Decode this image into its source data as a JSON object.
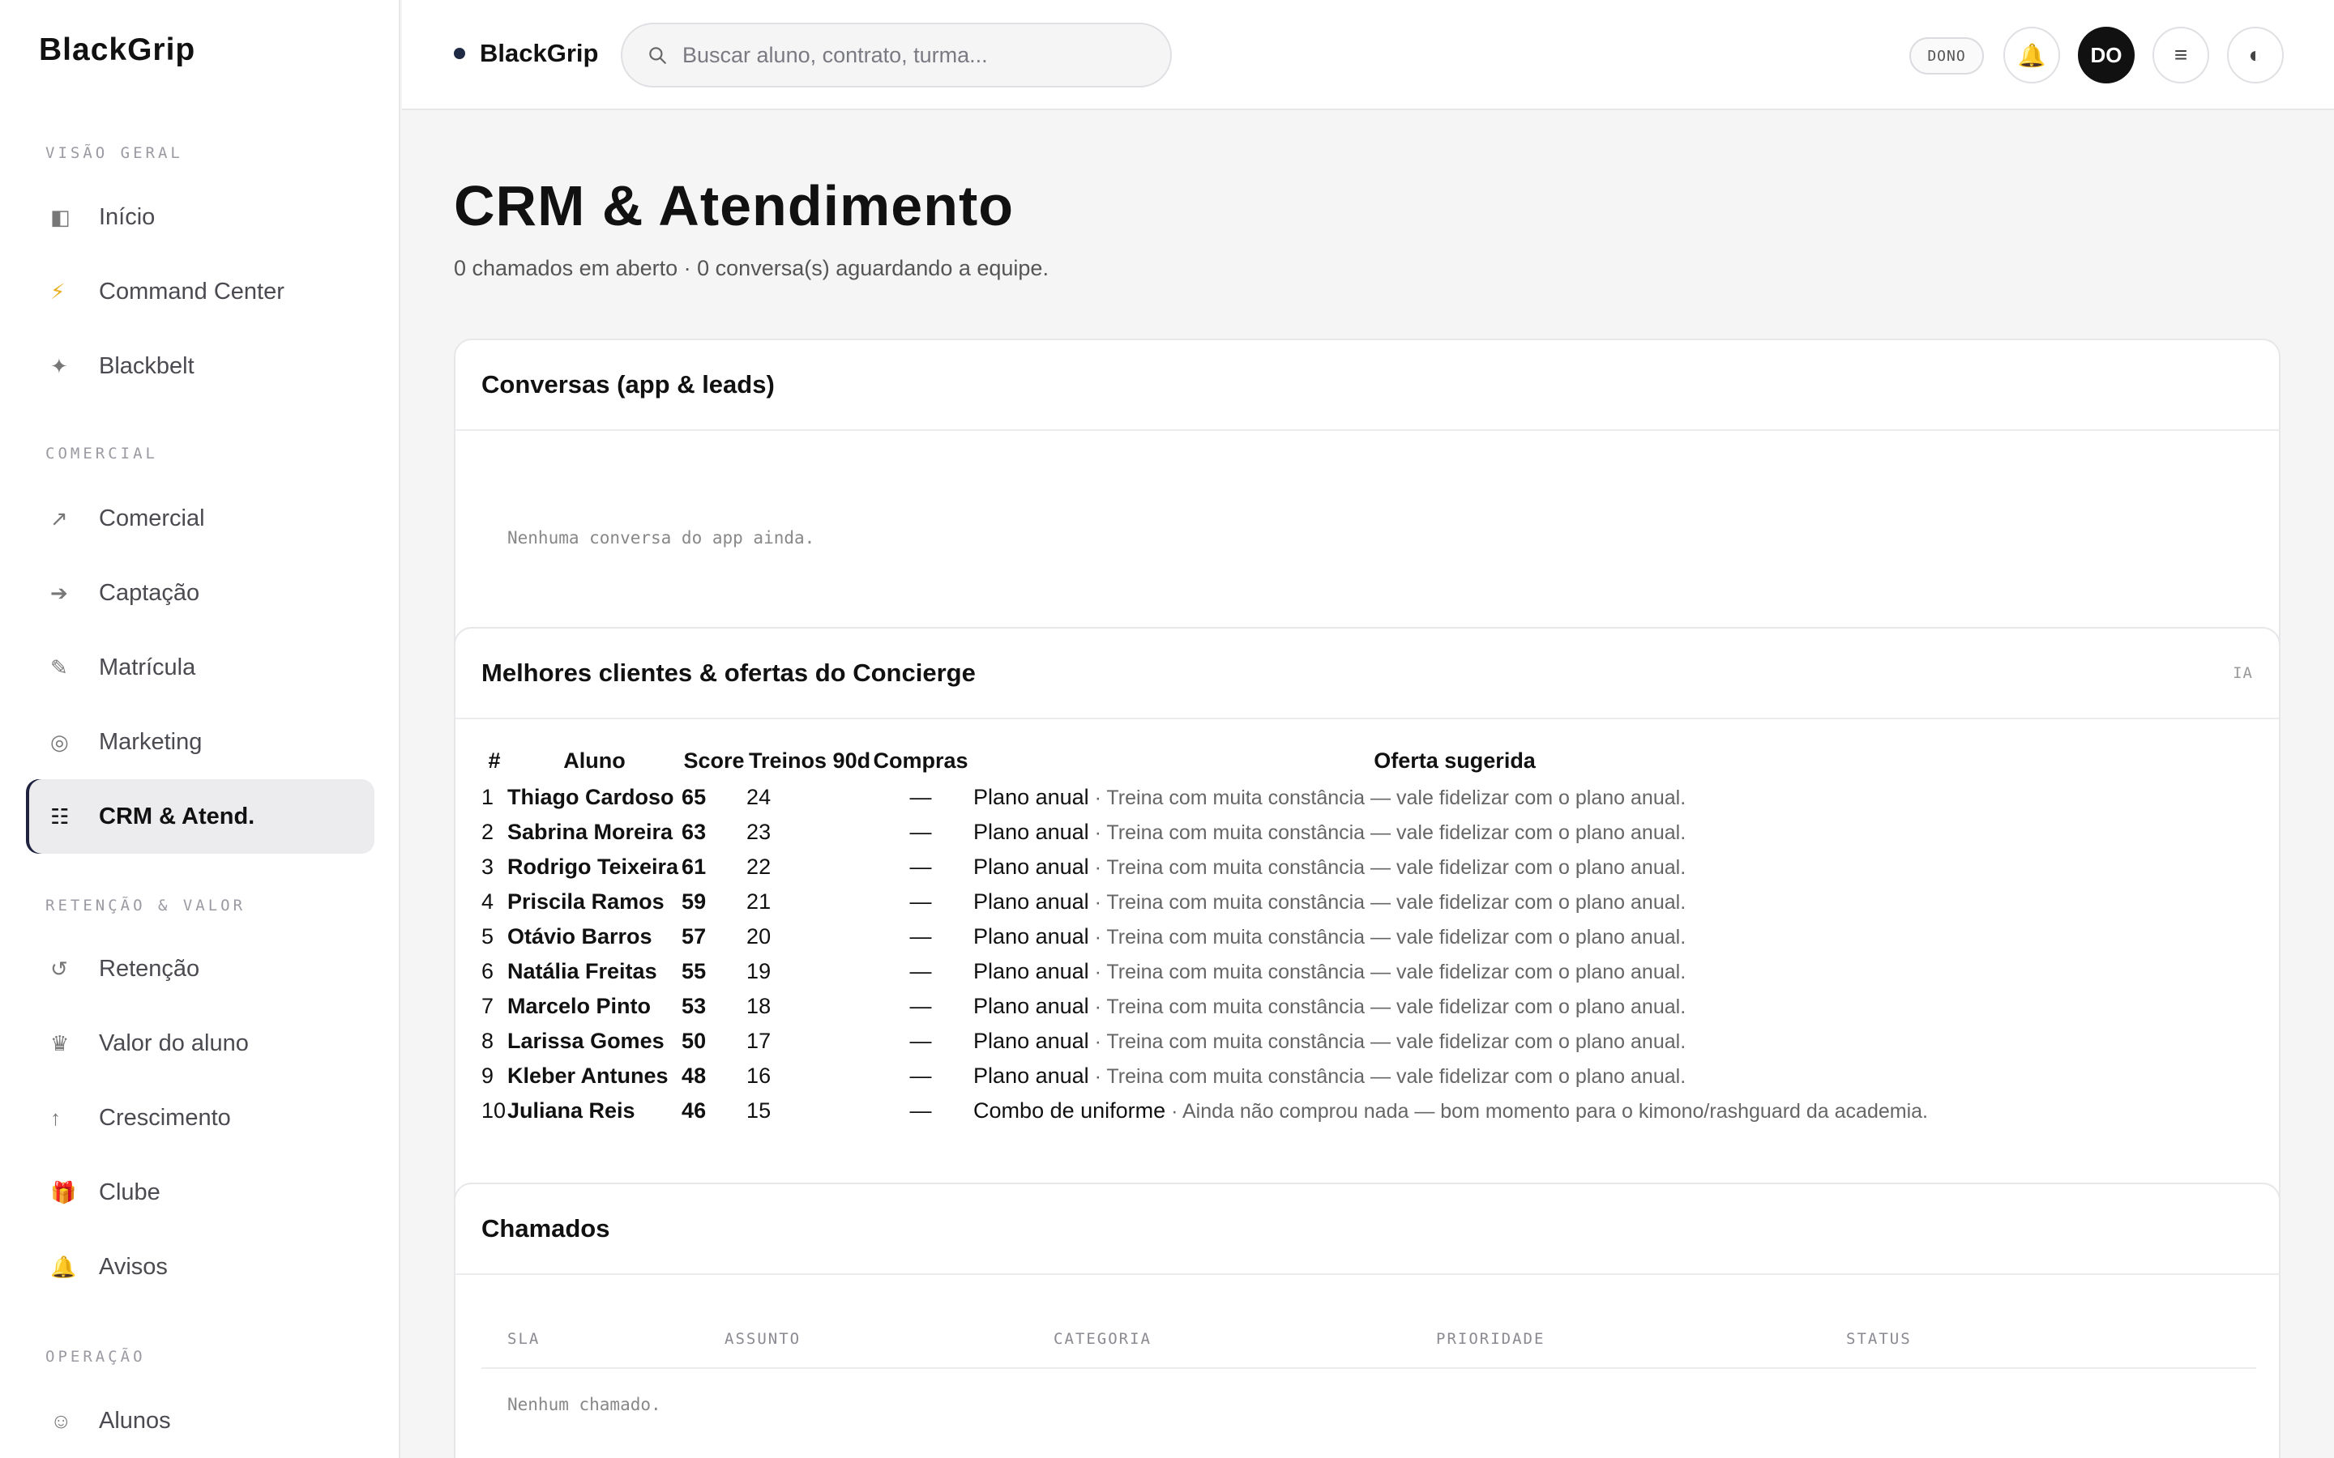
{
  "app": {
    "name": "BlackGrip"
  },
  "sidebar": {
    "brand": "BlackGrip",
    "sections": [
      {
        "title": "VISÃO GERAL"
      },
      {
        "title": "COMERCIAL"
      },
      {
        "title": "RETENÇÃO & VALOR"
      },
      {
        "title": "OPERAÇÃO"
      }
    ],
    "items": [
      {
        "label": "Início",
        "icon": "◧"
      },
      {
        "label": "Command Center",
        "icon": "⚡"
      },
      {
        "label": "Blackbelt",
        "icon": "✦"
      },
      {
        "label": "Comercial",
        "icon": "↗"
      },
      {
        "label": "Captação",
        "icon": "➔"
      },
      {
        "label": "Matrícula",
        "icon": "✎"
      },
      {
        "label": "Marketing",
        "icon": "◎"
      },
      {
        "label": "CRM & Atend.",
        "icon": "☷"
      },
      {
        "label": "Retenção",
        "icon": "↺"
      },
      {
        "label": "Valor do aluno",
        "icon": "♛"
      },
      {
        "label": "Crescimento",
        "icon": "↑"
      },
      {
        "label": "Clube",
        "icon": "🎁"
      },
      {
        "label": "Avisos",
        "icon": "🔔"
      },
      {
        "label": "Alunos",
        "icon": "☺"
      }
    ]
  },
  "topbar": {
    "brand": "BlackGrip",
    "search_placeholder": "Buscar aluno, contrato, turma...",
    "role_badge": "DONO",
    "avatar_initials": "DO",
    "bell_icon": "🔔",
    "menu_icon": "≡",
    "theme_icon": "◐"
  },
  "page": {
    "title": "CRM & Atendimento",
    "subtitle": "0 chamados em aberto · 0 conversa(s) aguardando a equipe."
  },
  "conversations": {
    "title": "Conversas (app & leads)",
    "empty": "Nenhuma conversa do app ainda."
  },
  "clients": {
    "title": "Melhores clientes & ofertas do Concierge",
    "badge": "IA",
    "columns": [
      "#",
      "Aluno",
      "Score",
      "Treinos 90d",
      "Compras",
      "Oferta sugerida"
    ],
    "rows": [
      {
        "rank": "1",
        "name": "Thiago Cardoso",
        "score": "65",
        "trainings": "24",
        "purchases": "—",
        "offer": "Plano anual",
        "reason": " · Treina com muita constância — vale fidelizar com o plano anual."
      },
      {
        "rank": "2",
        "name": "Sabrina Moreira",
        "score": "63",
        "trainings": "23",
        "purchases": "—",
        "offer": "Plano anual",
        "reason": " · Treina com muita constância — vale fidelizar com o plano anual."
      },
      {
        "rank": "3",
        "name": "Rodrigo Teixeira",
        "score": "61",
        "trainings": "22",
        "purchases": "—",
        "offer": "Plano anual",
        "reason": " · Treina com muita constância — vale fidelizar com o plano anual."
      },
      {
        "rank": "4",
        "name": "Priscila Ramos",
        "score": "59",
        "trainings": "21",
        "purchases": "—",
        "offer": "Plano anual",
        "reason": " · Treina com muita constância — vale fidelizar com o plano anual."
      },
      {
        "rank": "5",
        "name": "Otávio Barros",
        "score": "57",
        "trainings": "20",
        "purchases": "—",
        "offer": "Plano anual",
        "reason": " · Treina com muita constância — vale fidelizar com o plano anual."
      },
      {
        "rank": "6",
        "name": "Natália Freitas",
        "score": "55",
        "trainings": "19",
        "purchases": "—",
        "offer": "Plano anual",
        "reason": " · Treina com muita constância — vale fidelizar com o plano anual."
      },
      {
        "rank": "7",
        "name": "Marcelo Pinto",
        "score": "53",
        "trainings": "18",
        "purchases": "—",
        "offer": "Plano anual",
        "reason": " · Treina com muita constância — vale fidelizar com o plano anual."
      },
      {
        "rank": "8",
        "name": "Larissa Gomes",
        "score": "50",
        "trainings": "17",
        "purchases": "—",
        "offer": "Plano anual",
        "reason": " · Treina com muita constância — vale fidelizar com o plano anual."
      },
      {
        "rank": "9",
        "name": "Kleber Antunes",
        "score": "48",
        "trainings": "16",
        "purchases": "—",
        "offer": "Plano anual",
        "reason": " · Treina com muita constância — vale fidelizar com o plano anual."
      },
      {
        "rank": "10",
        "name": "Juliana Reis",
        "score": "46",
        "trainings": "15",
        "purchases": "—",
        "offer": "Combo de uniforme",
        "reason": " · Ainda não comprou nada — bom momento para o kimono/rashguard da academia."
      }
    ]
  },
  "tickets": {
    "title": "Chamados",
    "columns": [
      "SLA",
      "ASSUNTO",
      "CATEGORIA",
      "PRIORIDADE",
      "STATUS"
    ],
    "empty": "Nenhum chamado."
  },
  "colors": {
    "accent": "#1f2340",
    "active_bg": "#ececee",
    "page_bg": "#f5f5f6"
  }
}
